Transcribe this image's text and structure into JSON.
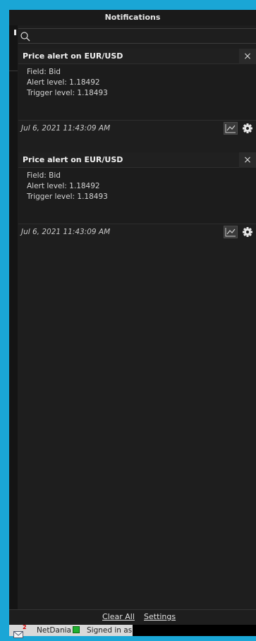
{
  "window": {
    "title": "Notifications"
  },
  "search": {
    "placeholder": "",
    "value": ""
  },
  "notifications": [
    {
      "title": "Price alert on EUR/USD",
      "field": "Field: Bid",
      "alert_level": "Alert level: 1.18492",
      "trigger_level": "Trigger level: 1.18493",
      "timestamp": "Jul 6, 2021 11:43:09 AM"
    },
    {
      "title": "Price alert on EUR/USD",
      "field": "Field: Bid",
      "alert_level": "Alert level: 1.18492",
      "trigger_level": "Trigger level: 1.18493",
      "timestamp": "Jul 6, 2021 11:43:09 AM"
    }
  ],
  "footer": {
    "clear_all": "Clear All",
    "settings": "Settings"
  },
  "status_bar": {
    "mail_badge": "2",
    "brand": "NetDania",
    "signed_in": "Signed in as"
  },
  "icons": {
    "close": "×",
    "search": "search-icon",
    "chart": "line-chart-icon",
    "gear": "gear-icon",
    "mail": "mail-icon"
  },
  "colors": {
    "frame": "#1aa6d6",
    "background": "#1e1e1e",
    "status_online": "#20b030",
    "badge": "#d00000"
  }
}
